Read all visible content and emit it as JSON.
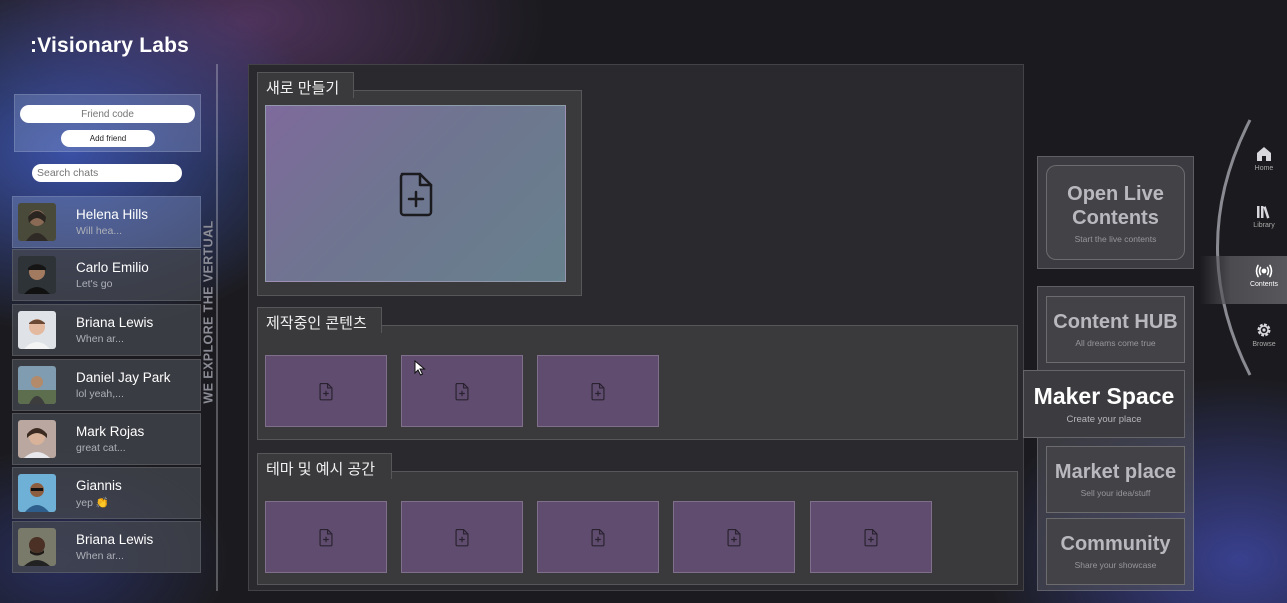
{
  "app": {
    "logo": ":Visionary Labs"
  },
  "friends": {
    "friend_code_placeholder": "Friend code",
    "add_friend_label": "Add friend",
    "search_placeholder": "Search chats"
  },
  "chats": [
    {
      "name": "Helena Hills",
      "preview": "Will hea...",
      "active": true
    },
    {
      "name": "Carlo Emilio",
      "preview": "Let's go"
    },
    {
      "name": "Briana Lewis",
      "preview": "When ar..."
    },
    {
      "name": "Daniel Jay Park",
      "preview": "lol yeah,..."
    },
    {
      "name": "Mark Rojas",
      "preview": "great cat..."
    },
    {
      "name": "Giannis",
      "preview": "yep 👏"
    },
    {
      "name": "Briana Lewis",
      "preview": "When ar..."
    }
  ],
  "tagline": "WE EXPLORE THE VERTUAL",
  "main": {
    "new_section_title": "새로 만들기",
    "in_progress_title": "제작중인 콘텐츠",
    "themes_title": "테마 및 예시 공간"
  },
  "nav_cards": {
    "open_live": {
      "title": "Open Live Contents",
      "subtitle": "Start the live contents"
    },
    "content_hub": {
      "title": "Content HUB",
      "subtitle": "All dreams come true"
    },
    "maker_space": {
      "title": "Maker Space",
      "subtitle": "Create your place"
    },
    "market_place": {
      "title": "Market place",
      "subtitle": "Sell your idea/stuff"
    },
    "community": {
      "title": "Community",
      "subtitle": "Share your showcase"
    }
  },
  "dock": {
    "home": "Home",
    "library": "Library",
    "contents": "Contents",
    "browse": "Browse"
  },
  "colors": {
    "accent_purple": "#5f4c6e",
    "panel": "#2a2a2e",
    "section": "#3a3a3d"
  }
}
